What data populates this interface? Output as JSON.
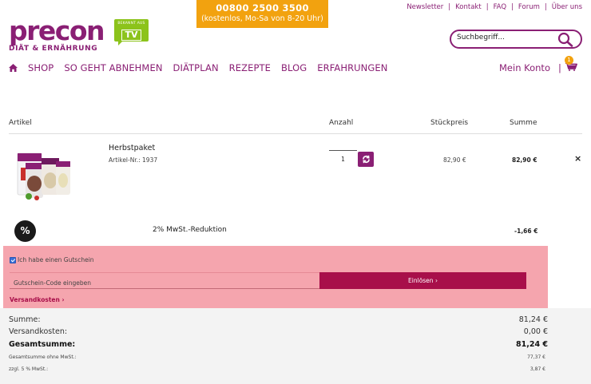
{
  "hotline": {
    "number": "00800 2500 3500",
    "hours": "(kostenlos, Mo-Sa von 8-20 Uhr)"
  },
  "toplinks": [
    "Newsletter",
    "Kontakt",
    "FAQ",
    "Forum",
    "Über uns"
  ],
  "logo": {
    "name": "precon",
    "tagline": "DIÄT & ERNÄHRUNG",
    "badge_small": "BEKANNT AUS",
    "badge_big": "TV"
  },
  "search": {
    "placeholder": "Suchbegriff..."
  },
  "nav": {
    "items": [
      "SHOP",
      "SO GEHT ABNEHMEN",
      "DIÄTPLAN",
      "REZEPTE",
      "BLOG",
      "ERFAHRUNGEN"
    ]
  },
  "account": {
    "label": "Mein Konto",
    "separator": "|",
    "cart_count": "1"
  },
  "table": {
    "headers": {
      "article": "Artikel",
      "qty": "Anzahl",
      "unit": "Stückpreis",
      "sum": "Summe"
    }
  },
  "item": {
    "name": "Herbstpaket",
    "article_no": "Artikel-Nr.: 1937",
    "qty": "1",
    "unit_price": "82,90 €",
    "sum": "82,90 €",
    "remove": "×"
  },
  "discount": {
    "icon": "%",
    "label": "2% MwSt.-Reduktion",
    "value": "-1,66 €"
  },
  "voucher": {
    "checkbox_label": "Ich habe einen Gutschein",
    "placeholder": "Gutschein-Code eingeben",
    "button": "Einlösen ›",
    "shipping_link": "Versandkosten ›"
  },
  "totals": {
    "subtotal_label": "Summe:",
    "subtotal": "81,24 €",
    "shipping_label": "Versandkosten:",
    "shipping": "0,00 €",
    "total_label": "Gesamtsumme:",
    "total": "81,24 €",
    "net_label": "Gesamtsumme ohne MwSt.:",
    "net": "77,37 €",
    "vat_label": "zzgl. 5 % MwSt.:",
    "vat": "3,87 €"
  },
  "colors": {
    "brand": "#8a1f74",
    "accent": "#f2a20f",
    "badge": "#8cc31b",
    "button": "#a80f4a",
    "highlight": "#f5a5ae"
  }
}
